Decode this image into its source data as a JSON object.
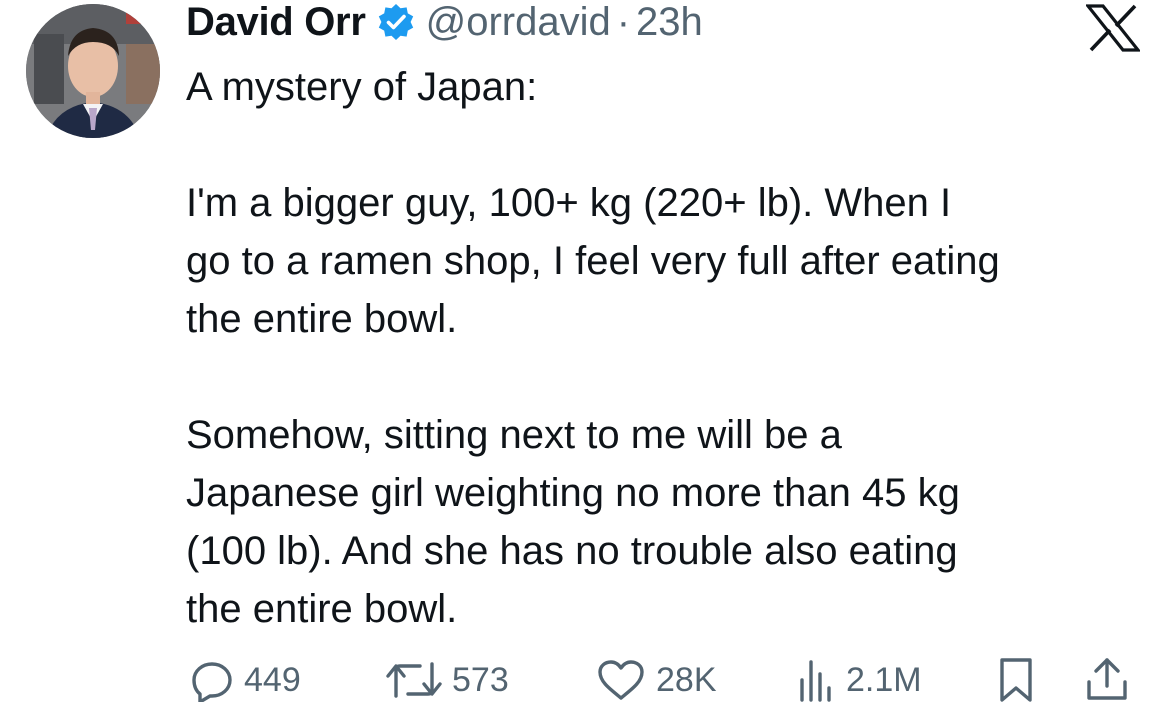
{
  "tweet": {
    "author_name": "David Orr",
    "author_handle": "@orrdavid",
    "separator": "·",
    "time": "23h",
    "verified_icon": "verified-badge-icon",
    "platform_icon": "x-logo-icon",
    "text_line1": "A mystery of Japan:",
    "text_para2": "I'm a bigger guy, 100+ kg (220+ lb).  When I\ngo to a ramen shop, I feel very full after eating\nthe entire bowl.",
    "text_para3": "Somehow, sitting next to me will be a\nJapanese girl weighting no more than 45 kg\n(100 lb).  And she has no trouble also eating\nthe entire bowl."
  },
  "actions": {
    "replies": "449",
    "reposts": "573",
    "likes": "28K",
    "views": "2.1M",
    "reply_icon": "reply-icon",
    "repost_icon": "repost-icon",
    "like_icon": "heart-icon",
    "views_icon": "views-icon",
    "bookmark_icon": "bookmark-icon",
    "share_icon": "share-icon"
  },
  "colors": {
    "text": "#0f1419",
    "secondary": "#536471",
    "verified": "#1d9bf0",
    "background": "#ffffff"
  }
}
